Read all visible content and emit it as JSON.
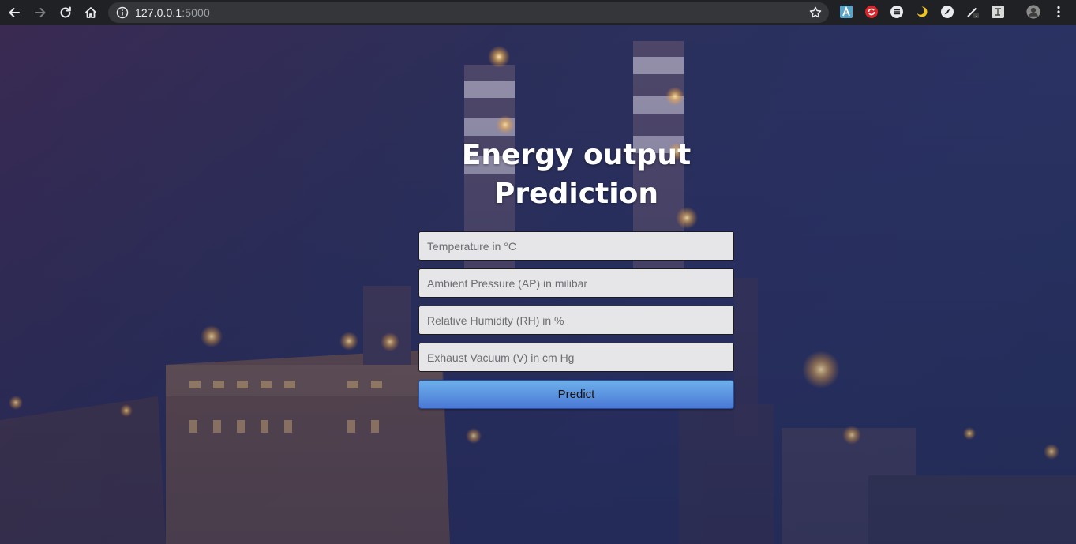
{
  "browser": {
    "url_host": "127.0.0.1",
    "url_port": ":5000",
    "nav_icons": [
      "back-icon",
      "forward-icon",
      "reload-icon",
      "home-icon"
    ],
    "extension_icons": [
      "extension-a-icon",
      "extension-red-icon",
      "extension-lines-icon",
      "extension-moon-icon",
      "extension-compass-icon",
      "extension-pen-icon",
      "extension-square-icon",
      "profile-avatar",
      "menu-icon"
    ]
  },
  "page": {
    "title": "Energy output Prediction",
    "form": {
      "temperature_placeholder": "Temperature in °C",
      "pressure_placeholder": "Ambient Pressure (AP) in milibar",
      "humidity_placeholder": "Relative Humidity (RH) in %",
      "vacuum_placeholder": "Exhaust Vacuum (V) in cm Hg",
      "submit_label": "Predict"
    }
  },
  "colors": {
    "chrome_bg": "#202124",
    "omnibox_bg": "#35363a",
    "button_top": "#6eb0ea",
    "button_bottom": "#4a78d6",
    "field_bg": "#e6e6e9"
  }
}
